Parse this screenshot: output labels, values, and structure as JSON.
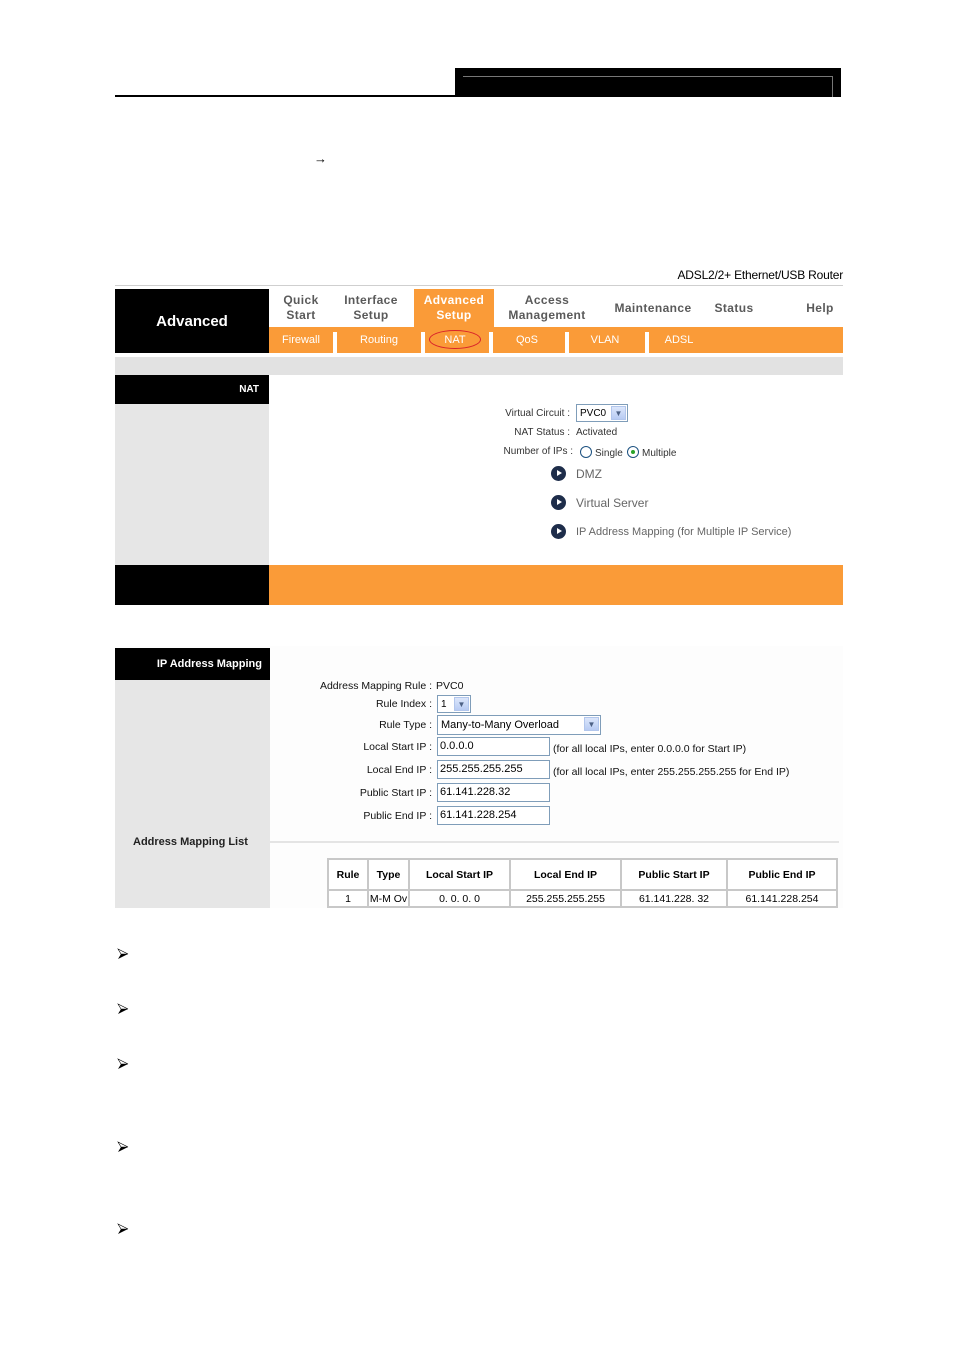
{
  "document": {
    "arrow_glyph": "→",
    "bullet_glyph": "➢",
    "bullet_count": 5
  },
  "router_ui": {
    "product_name": "ADSL2/2+ Ethernet/USB Router",
    "brand_label": "Advanced",
    "main_nav": [
      {
        "line1": "Quick",
        "line2": "Start",
        "active": false
      },
      {
        "line1": "Interface",
        "line2": "Setup",
        "active": false
      },
      {
        "line1": "Advanced",
        "line2": "Setup",
        "active": true
      },
      {
        "line1": "Access",
        "line2": "Management",
        "active": false
      },
      {
        "line1": "Maintenance",
        "line2": "",
        "active": false
      },
      {
        "line1": "Status",
        "line2": "",
        "active": false
      },
      {
        "line1": "Help",
        "line2": "",
        "active": false
      }
    ],
    "sub_nav": [
      {
        "label": "Firewall",
        "highlighted": false
      },
      {
        "label": "Routing",
        "highlighted": false
      },
      {
        "label": "NAT",
        "highlighted": true
      },
      {
        "label": "QoS",
        "highlighted": false
      },
      {
        "label": "VLAN",
        "highlighted": false
      },
      {
        "label": "ADSL",
        "highlighted": false
      }
    ],
    "colors": {
      "accent_orange": "#fa9b38",
      "header_black": "#000000",
      "sidebar_grey": "#e6e6e6",
      "highlight_circle": "#d9232a"
    }
  },
  "nat_panel": {
    "section_title": "NAT",
    "virtual_circuit_label": "Virtual Circuit :",
    "virtual_circuit_value": "PVC0",
    "nat_status_label": "NAT Status :",
    "nat_status_value": "Activated",
    "num_ips_label": "Number of IPs :",
    "num_ips_options": [
      {
        "label": "Single",
        "checked": false
      },
      {
        "label": "Multiple",
        "checked": true
      }
    ],
    "links": [
      "DMZ",
      "Virtual Server",
      "IP Address Mapping (for Multiple IP Service)"
    ]
  },
  "ip_mapping_panel": {
    "section_title": "IP Address Mapping",
    "list_title": "Address Mapping List",
    "fields": {
      "rule_label": "Address Mapping Rule :",
      "rule_value": "PVC0",
      "rule_index_label": "Rule Index :",
      "rule_index_value": "1",
      "rule_type_label": "Rule Type :",
      "rule_type_value": "Many-to-Many Overload",
      "local_start_label": "Local Start IP :",
      "local_start_value": "0.0.0.0",
      "local_start_hint": "(for all local IPs, enter 0.0.0.0 for Start IP)",
      "local_end_label": "Local End IP :",
      "local_end_value": "255.255.255.255",
      "local_end_hint": "(for all local IPs, enter 255.255.255.255 for End IP)",
      "public_start_label": "Public Start IP :",
      "public_start_value": "61.141.228.32",
      "public_end_label": "Public End IP :",
      "public_end_value": "61.141.228.254"
    },
    "table": {
      "columns": [
        "Rule",
        "Type",
        "Local Start IP",
        "Local End IP",
        "Public Start IP",
        "Public End IP"
      ],
      "rows": [
        [
          "1",
          "M-M Ov",
          "0. 0. 0. 0",
          "255.255.255.255",
          "61.141.228. 32",
          "61.141.228.254"
        ]
      ]
    }
  }
}
